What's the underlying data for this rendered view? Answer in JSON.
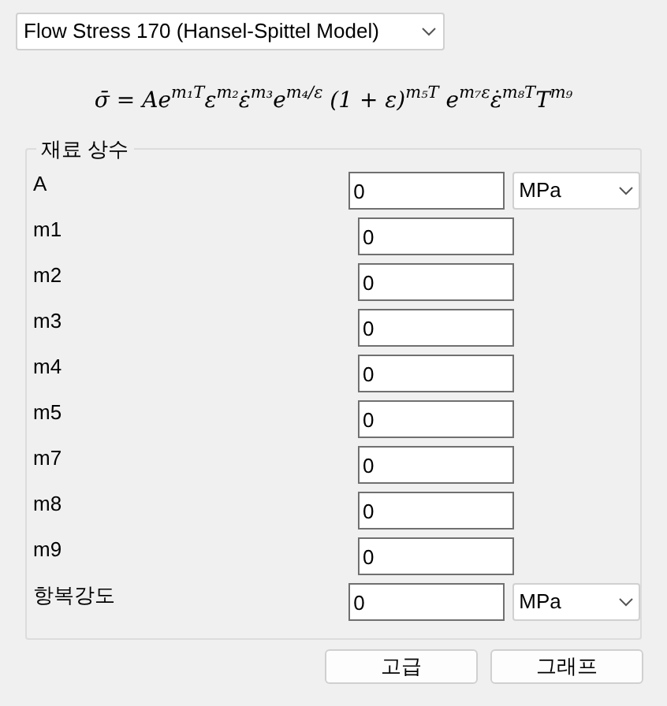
{
  "model_select": {
    "value": "Flow Stress 170 (Hansel-Spittel Model)"
  },
  "formula": "σ̄ = Ae$^{m₁T}$ε$^{m₂}$ε̇$^{m₃}$e$^{m₄/ε}$ (1 + ε)$^{m₅T}$ e$^{m₇ε}$ε̇$^{m₈T}$T$^{m₉}$",
  "group": {
    "title": "재료 상수",
    "fields": [
      {
        "label": "A",
        "value": "0",
        "unit": "MPa"
      },
      {
        "label": "m1",
        "value": "0"
      },
      {
        "label": "m2",
        "value": "0"
      },
      {
        "label": "m3",
        "value": "0"
      },
      {
        "label": "m4",
        "value": "0"
      },
      {
        "label": "m5",
        "value": "0"
      },
      {
        "label": "m7",
        "value": "0"
      },
      {
        "label": "m8",
        "value": "0"
      },
      {
        "label": "m9",
        "value": "0"
      },
      {
        "label": "항복강도",
        "value": "0",
        "unit": "MPa"
      }
    ]
  },
  "buttons": [
    "고급",
    "그래프"
  ]
}
